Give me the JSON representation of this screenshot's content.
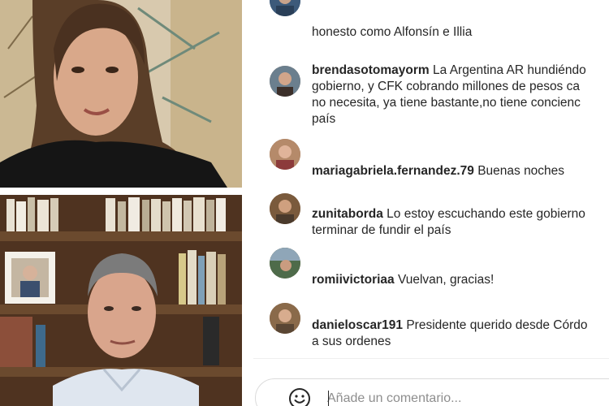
{
  "comments": [
    {
      "username": "",
      "text": "honesto como Alfonsín e Illia"
    },
    {
      "username": "brendasotomayorm",
      "text": "La Argentina AR hundiéndo\ngobierno, y CFK cobrando millones de pesos ca\nno necesita, ya tiene bastante,no tiene concienc\npaís"
    },
    {
      "username": "mariagabriela.fernandez.79",
      "text": "Buenas noches"
    },
    {
      "username": "zunitaborda",
      "text": "Lo estoy escuchando este gobierno\nterminar de fundir el país"
    },
    {
      "username": "romiivictoriaa",
      "text": "Vuelvan, gracias!"
    },
    {
      "username": "danieloscar191",
      "text": "Presidente querido desde Córdo\na sus ordenes"
    }
  ],
  "comment_input": {
    "placeholder": "Añade un comentario..."
  },
  "icons": {
    "emoji": "smiley-icon"
  }
}
